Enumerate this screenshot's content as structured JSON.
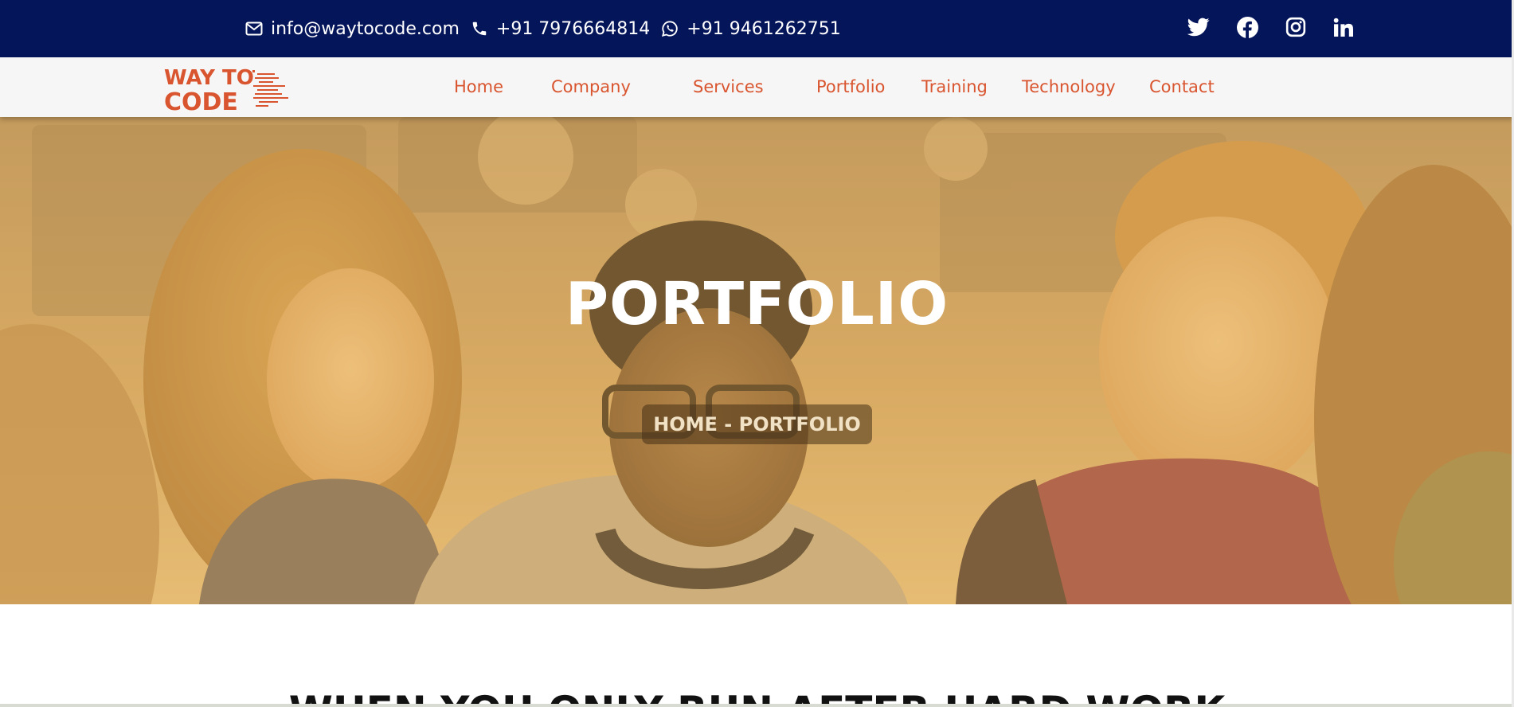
{
  "topbar": {
    "email": "info@waytocode.com",
    "phone": "+91 7976664814",
    "whatsapp": "+91 9461262751",
    "colors": {
      "background": "#05155a",
      "text": "#ffffff"
    },
    "social_icons": [
      "twitter-icon",
      "facebook-icon",
      "instagram-icon",
      "linkedin-icon"
    ]
  },
  "logo": {
    "line1": "WAY TO",
    "line2": "CODE",
    "color": "#d9552f"
  },
  "nav": {
    "items": [
      {
        "label": "Home"
      },
      {
        "label": "Company"
      },
      {
        "label": "Services"
      },
      {
        "label": "Portfolio"
      },
      {
        "label": "Training"
      },
      {
        "label": "Technology"
      },
      {
        "label": "Contact"
      }
    ],
    "link_color": "#d9552f",
    "background": "#f6f6f6"
  },
  "hero": {
    "title": "PORTFOLIO",
    "breadcrumb": "HOME - PORTFOLIO",
    "overlay_color": "#d6a760"
  },
  "section": {
    "heading": "WHEN YOU ONLY RUN AFTER HARD WORK"
  }
}
